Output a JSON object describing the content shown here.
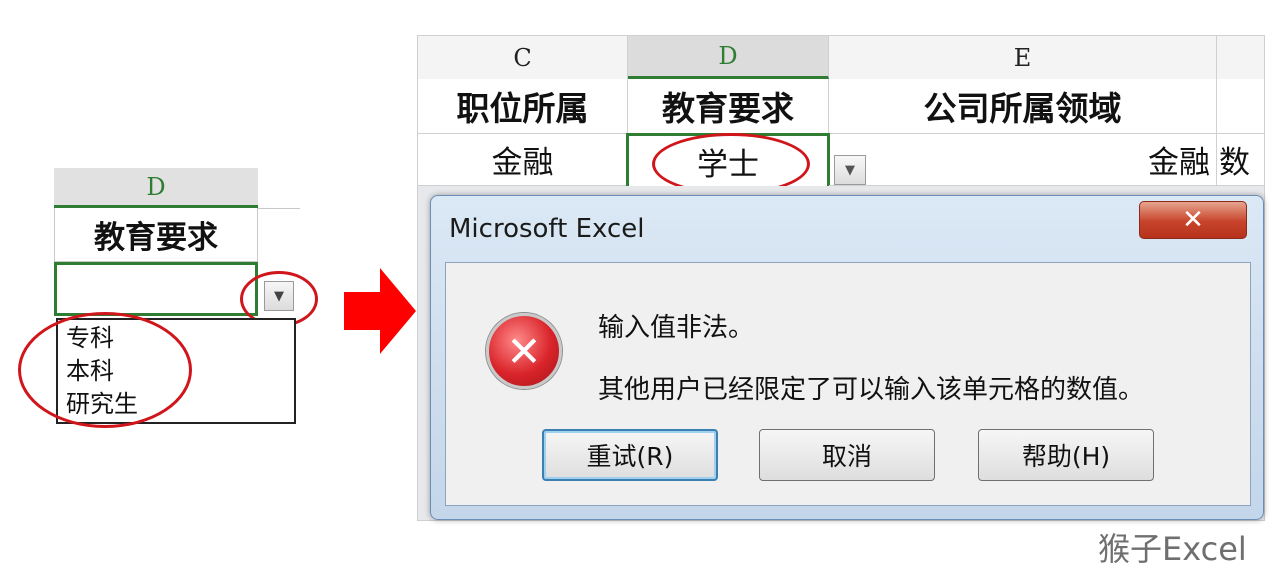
{
  "left_panel": {
    "column_letter": "D",
    "header": "教育要求",
    "list_items": [
      "专科",
      "本科",
      "研究生"
    ]
  },
  "sheet": {
    "columns": [
      "C",
      "D",
      "E"
    ],
    "headers": [
      "职位所属",
      "教育要求",
      "公司所属领域"
    ],
    "row_values": [
      "金融",
      "学士",
      "金融"
    ],
    "partial_cell": "数"
  },
  "dialog": {
    "title": "Microsoft Excel",
    "close_glyph": "✕",
    "error_glyph": "✕",
    "message_line1": "输入值非法。",
    "message_line2": "其他用户已经限定了可以输入该单元格的数值。",
    "buttons": {
      "retry": "重试(R)",
      "cancel": "取消",
      "help": "帮助(H)"
    }
  },
  "icons": {
    "dropdown": "▼",
    "arrow": "arrow-right-icon",
    "error": "error-icon"
  },
  "watermark": "猴子Excel",
  "colors": {
    "annotation_red": "#d0151b",
    "arrow_red": "#ff0000",
    "active_green": "#2e7d32"
  }
}
